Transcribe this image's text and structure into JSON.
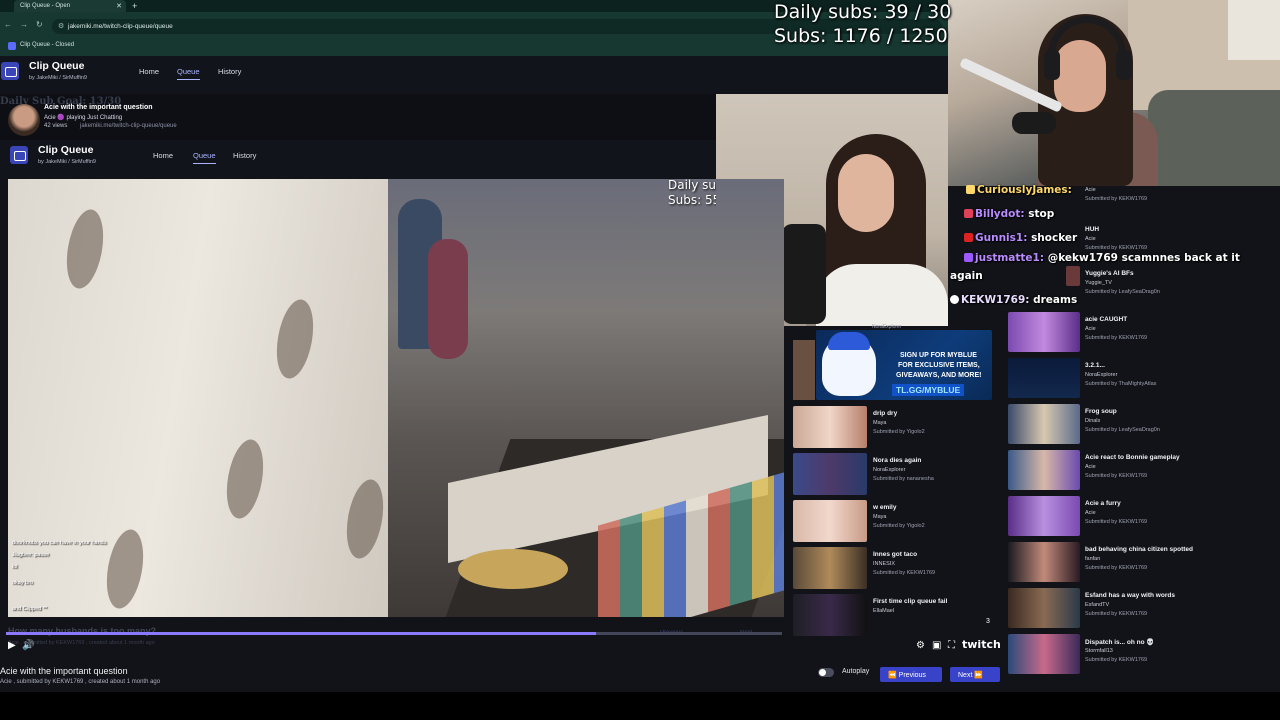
{
  "browser": {
    "tabs": [
      {
        "label": "Clip Queue - Open"
      }
    ],
    "new_tab": "+",
    "url": "jakemiki.me/twitch-clip-queue/queue",
    "bookmark": "Clip Queue - Closed"
  },
  "app": {
    "title": "Clip Queue",
    "by": "by JakeMiki / SirMuffin9",
    "nav": [
      "Home",
      "Queue",
      "History"
    ]
  },
  "overlay_subs": {
    "daily": "Daily subs: 39 / 30",
    "total": "Subs: 1176 / 1250"
  },
  "chat": [
    {
      "name": "CuriouslyJames:",
      "message": "",
      "badge_color": "#ffd86b"
    },
    {
      "name": "Billydot:",
      "message": "stop",
      "badge_color": "#e0405a"
    },
    {
      "name": "Gunnis1:",
      "message": "shocker",
      "badge_color": "#d22"
    },
    {
      "name": "justmatte1:",
      "message": "@kekw1769 scamnnes back at it",
      "badge_color": "#9b59ff"
    },
    {
      "name": "",
      "message": "again",
      "badge_color": ""
    },
    {
      "name": "KEKW1769:",
      "message": "dreams",
      "badge_color": "#ffffff"
    }
  ],
  "outer_queue": [
    {
      "title": "",
      "channel": "Acie",
      "submitted": "Submitted by KEKW1769"
    },
    {
      "title": "HUH",
      "channel": "Acie",
      "submitted": "Submitted by KEKW1769"
    },
    {
      "title": "Yuggie's AI BFs",
      "channel": "Yuggie_TV",
      "submitted": "Submitted by LeafySeaDrag0n"
    },
    {
      "title": "acie CAUGHT",
      "channel": "Acie",
      "submitted": "Submitted by KEKW1769"
    },
    {
      "title": "3.2.1...",
      "channel": "NoraExplorer",
      "submitted": "Submitted by ThaMightyAtlas"
    },
    {
      "title": "Frog soup",
      "channel": "Dinals",
      "submitted": "Submitted by LeafySeaDrag0n"
    },
    {
      "title": "Acie react to Bonnie gameplay",
      "channel": "Acie",
      "submitted": "Submitted by KEKW1769"
    },
    {
      "title": "Acie a furry",
      "channel": "Acie",
      "submitted": "Submitted by KEKW1769"
    },
    {
      "title": "bad behaving china citizen spotted",
      "channel": "fanfan",
      "submitted": "Submitted by KEKW1769"
    },
    {
      "title": "Esfand has a way with words",
      "channel": "EsfandTV",
      "submitted": "Submitted by KEKW1769"
    },
    {
      "title": "Dispatch is... oh no 💀",
      "channel": "Stormfall13",
      "submitted": "Submitted by KEKW1769"
    }
  ],
  "inner": {
    "goal": "Daily Sub Goal: 13/30",
    "stream_title": "Acie with the important question",
    "stream_meta": "Acie 🟣 playing Just Chatting",
    "views": "42 views",
    "url": "jakemiki.me/twitch-clip-queue/queue",
    "overlay_subs": "Daily su Subs: 55",
    "overlay_line1": "Daily su",
    "overlay_line2": "Subs: 55",
    "chat": [
      "doorknobs you can have in your hands",
      "Jiagbee: pause",
      "lol",
      "okay bro",
      "and Clipped **"
    ],
    "ghost_title": "How many husbands is too many?",
    "ghost_meta": "Acie . submitted by KEKW1769 , created about 1 month ago",
    "prev": "Previous",
    "next": "Next",
    "ad": {
      "l1": "SIGN UP FOR MYBLUE",
      "l2": "FOR EXCLUSIVE ITEMS,",
      "l3": "GIVEAWAYS, AND MORE!",
      "l4": "TL.GG/MYBLUE"
    },
    "ad_caption": "NoraExplorer",
    "queue": [
      {
        "title": "drip dry",
        "channel": "Maya",
        "submitted": "Submitted by Yigolo2"
      },
      {
        "title": "Nora dies again",
        "channel": "NoraExplorer",
        "submitted": "Submitted by nananesha"
      },
      {
        "title": "w emily",
        "channel": "Maya",
        "submitted": "Submitted by Yigolo2"
      },
      {
        "title": "Innes got taco",
        "channel": "INNESIX",
        "submitted": "Submitted by KEKW1769"
      },
      {
        "title": "First time clip queue fail",
        "channel": "EllaMael",
        "submitted": ""
      }
    ],
    "page": "3"
  },
  "player": {
    "twitch": "twitch",
    "progress": 0.76
  },
  "clip": {
    "title": "Acie with the important question",
    "meta": "Acie , submitted by KEKW1769 , created about 1 month ago"
  },
  "controls": {
    "autoplay": "Autoplay",
    "previous": "Previous",
    "next": "Next"
  },
  "colors": {
    "accent": "#3943c9",
    "progress": "#8a78ff",
    "chat_name": "#b98cff"
  }
}
